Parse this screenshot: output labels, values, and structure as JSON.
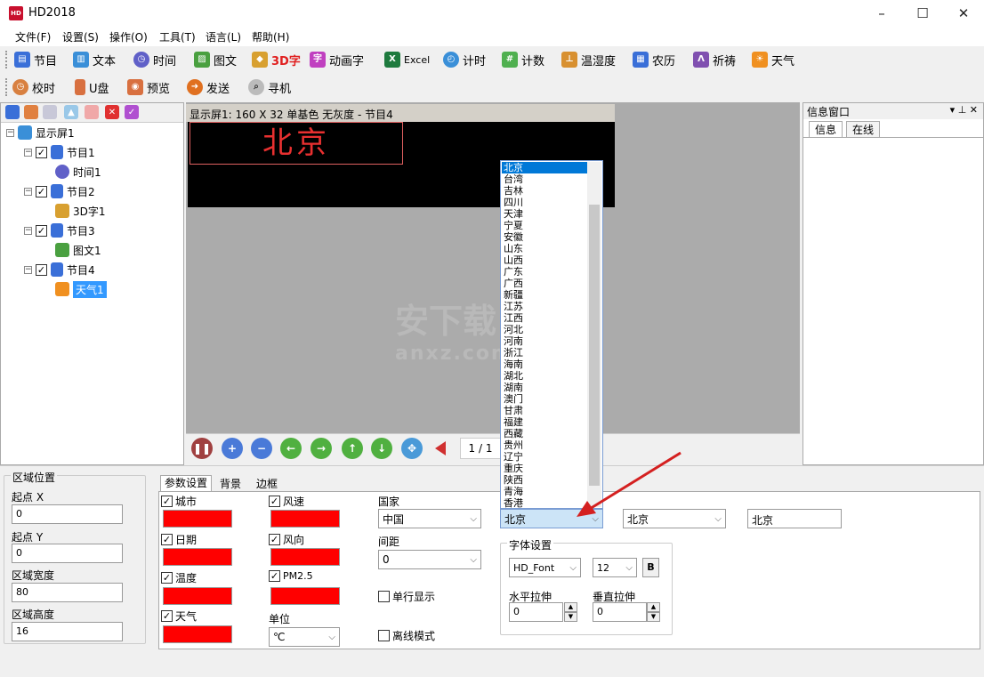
{
  "window": {
    "title": "HD2018"
  },
  "menu": [
    "文件(F)",
    "设置(S)",
    "操作(O)",
    "工具(T)",
    "语言(L)",
    "帮助(H)"
  ],
  "toolbar1": [
    {
      "label": "节目",
      "icon": "program-icon",
      "color": "#3a6fd8"
    },
    {
      "label": "文本",
      "icon": "book-icon",
      "color": "#3a8fd8"
    },
    {
      "label": "时间",
      "icon": "clock-icon",
      "color": "#6060c8"
    },
    {
      "label": "图文",
      "icon": "image-icon",
      "color": "#4aa040"
    },
    {
      "label": "3D字",
      "icon": "cube-icon",
      "color": "#d8a030"
    },
    {
      "label": "动画字",
      "icon": "animation-icon",
      "color": "#c040c0"
    },
    {
      "label": "Excel",
      "icon": "excel-icon",
      "color": "#1e7a3e"
    },
    {
      "label": "计时",
      "icon": "timer-icon",
      "color": "#3a8fd8"
    },
    {
      "label": "计数",
      "icon": "counter-icon",
      "color": "#50b050"
    },
    {
      "label": "温湿度",
      "icon": "thermometer-icon",
      "color": "#d89030"
    },
    {
      "label": "农历",
      "icon": "calendar-icon",
      "color": "#3a6fd8"
    },
    {
      "label": "祈祷",
      "icon": "pray-icon",
      "color": "#8050b0"
    },
    {
      "label": "天气",
      "icon": "weather-icon",
      "color": "#f09020"
    }
  ],
  "toolbar2": [
    {
      "label": "校时",
      "icon": "sync-clock-icon",
      "color": "#d88040"
    },
    {
      "label": "U盘",
      "icon": "usb-icon",
      "color": "#d87040"
    },
    {
      "label": "预览",
      "icon": "camera-icon",
      "color": "#d87040"
    },
    {
      "label": "发送",
      "icon": "send-icon",
      "color": "#e07020"
    },
    {
      "label": "寻机",
      "icon": "find-device-icon",
      "color": "#606060"
    }
  ],
  "tree": {
    "root": "显示屏1",
    "items": [
      {
        "label": "节目1",
        "children": [
          "时间1"
        ]
      },
      {
        "label": "节目2",
        "children": [
          "3D字1"
        ]
      },
      {
        "label": "节目3",
        "children": [
          "图文1"
        ]
      },
      {
        "label": "节目4",
        "children": [
          "天气1"
        ]
      }
    ]
  },
  "screen": {
    "header": "显示屏1: 160 X 32  单基色 无灰度 - 节目4",
    "led_text": "北京"
  },
  "controls": {
    "page": "1 / 1"
  },
  "info_window": {
    "title": "信息窗口",
    "tabs": [
      "信息",
      "在线"
    ],
    "pin": "▾ ⊥ ✕"
  },
  "region": {
    "title": "区域位置",
    "x_label": "起点 X",
    "x": "0",
    "y_label": "起点 Y",
    "y": "0",
    "w_label": "区域宽度",
    "w": "80",
    "h_label": "区域高度",
    "h": "16"
  },
  "params": {
    "tabs": [
      "参数设置",
      "背景",
      "边框"
    ],
    "checks_left": [
      "城市",
      "日期",
      "温度",
      "天气"
    ],
    "checks_right": [
      "风速",
      "风向",
      "PM2.5"
    ],
    "unit_label": "单位",
    "unit": "℃",
    "country_label": "国家",
    "country": "中国",
    "spacing_label": "间距",
    "spacing": "0",
    "single_line": "单行显示",
    "offline": "离线模式",
    "province": "北京",
    "city": "北京",
    "city_text": "北京",
    "font_group": "字体设置",
    "font": "HD_Font",
    "size": "12",
    "bold": "B",
    "h_stretch_label": "水平拉伸",
    "h_stretch": "0",
    "v_stretch_label": "垂直拉伸",
    "v_stretch": "0"
  },
  "province_options": [
    "北京",
    "台湾",
    "吉林",
    "四川",
    "天津",
    "宁夏",
    "安徽",
    "山东",
    "山西",
    "广东",
    "广西",
    "新疆",
    "江苏",
    "江西",
    "河北",
    "河南",
    "浙江",
    "海南",
    "湖北",
    "湖南",
    "澳门",
    "甘肃",
    "福建",
    "西藏",
    "贵州",
    "辽宁",
    "重庆",
    "陕西",
    "青海",
    "香港"
  ],
  "watermark": "安下载",
  "watermark_sub": "anxz.com"
}
